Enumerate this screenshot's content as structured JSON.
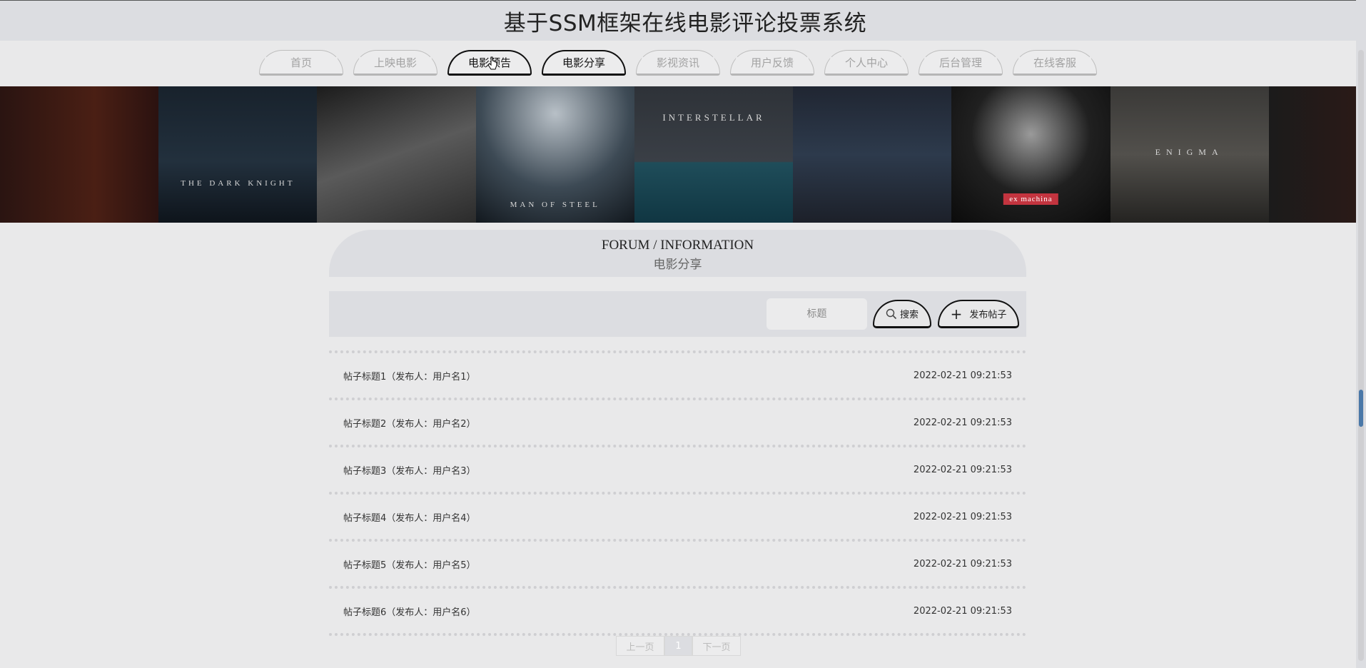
{
  "site_title": "基于SSM框架在线电影评论投票系统",
  "nav": [
    {
      "label": "首页",
      "active": false
    },
    {
      "label": "上映电影",
      "active": false
    },
    {
      "label": "电影预告",
      "active": true
    },
    {
      "label": "电影分享",
      "active": true
    },
    {
      "label": "影视资讯",
      "active": false
    },
    {
      "label": "用户反馈",
      "active": false
    },
    {
      "label": "个人中心",
      "active": false
    },
    {
      "label": "后台管理",
      "active": false
    },
    {
      "label": "在线客服",
      "active": false
    }
  ],
  "banner": {
    "posters": [
      {
        "text": "",
        "tag": ""
      },
      {
        "text": "THE DARK KNIGHT",
        "tag": ""
      },
      {
        "text": "",
        "tag": ""
      },
      {
        "text": "MAN OF STEEL",
        "tag": ""
      },
      {
        "text": "INTERSTELLAR",
        "tag": ""
      },
      {
        "text": "",
        "tag": ""
      },
      {
        "text": "",
        "tag": "ex machina"
      },
      {
        "text": "ENIGMA",
        "tag": ""
      },
      {
        "text": "",
        "tag": ""
      }
    ]
  },
  "section": {
    "title_en": "FORUM / INFORMATION",
    "title_cn": "电影分享"
  },
  "search": {
    "placeholder": "标题",
    "search_label": "搜索",
    "post_label": "发布帖子"
  },
  "posts": [
    {
      "title": "帖子标题1（发布人：用户名1）",
      "time": "2022-02-21 09:21:53"
    },
    {
      "title": "帖子标题2（发布人：用户名2）",
      "time": "2022-02-21 09:21:53"
    },
    {
      "title": "帖子标题3（发布人：用户名3）",
      "time": "2022-02-21 09:21:53"
    },
    {
      "title": "帖子标题4（发布人：用户名4）",
      "time": "2022-02-21 09:21:53"
    },
    {
      "title": "帖子标题5（发布人：用户名5）",
      "time": "2022-02-21 09:21:53"
    },
    {
      "title": "帖子标题6（发布人：用户名6）",
      "time": "2022-02-21 09:21:53"
    }
  ],
  "pagination": {
    "prev_label": "上一页",
    "current": "1",
    "next_label": "下一页"
  }
}
